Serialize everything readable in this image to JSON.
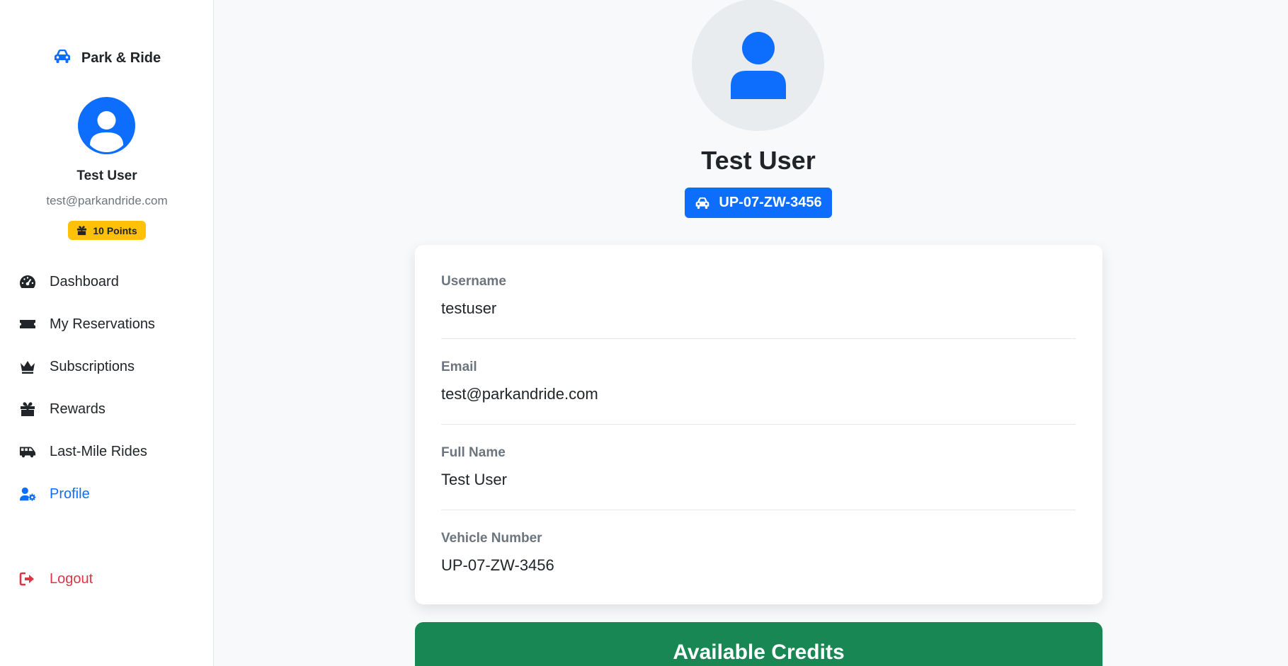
{
  "brand": {
    "name": "Park & Ride",
    "icon": "car-icon"
  },
  "user": {
    "name": "Test User",
    "email": "test@parkandride.com",
    "points_label": "10 Points"
  },
  "nav": {
    "items": [
      {
        "label": "Dashboard",
        "icon": "gauge-icon"
      },
      {
        "label": "My Reservations",
        "icon": "ticket-icon"
      },
      {
        "label": "Subscriptions",
        "icon": "crown-icon"
      },
      {
        "label": "Rewards",
        "icon": "gift-icon"
      },
      {
        "label": "Last-Mile Rides",
        "icon": "shuttle-van-icon"
      },
      {
        "label": "Profile",
        "icon": "user-gear-icon",
        "active": true
      }
    ],
    "logout_label": "Logout"
  },
  "profile": {
    "name": "Test User",
    "vehicle_badge": "UP-07-ZW-3456",
    "fields": [
      {
        "label": "Username",
        "value": "testuser"
      },
      {
        "label": "Email",
        "value": "test@parkandride.com"
      },
      {
        "label": "Full Name",
        "value": "Test User"
      },
      {
        "label": "Vehicle Number",
        "value": "UP-07-ZW-3456"
      }
    ]
  },
  "credits": {
    "title": "Available Credits"
  },
  "colors": {
    "primary": "#0d6efd",
    "warning": "#ffc107",
    "danger": "#dc3545",
    "success": "#198754",
    "muted": "#6c757d"
  }
}
